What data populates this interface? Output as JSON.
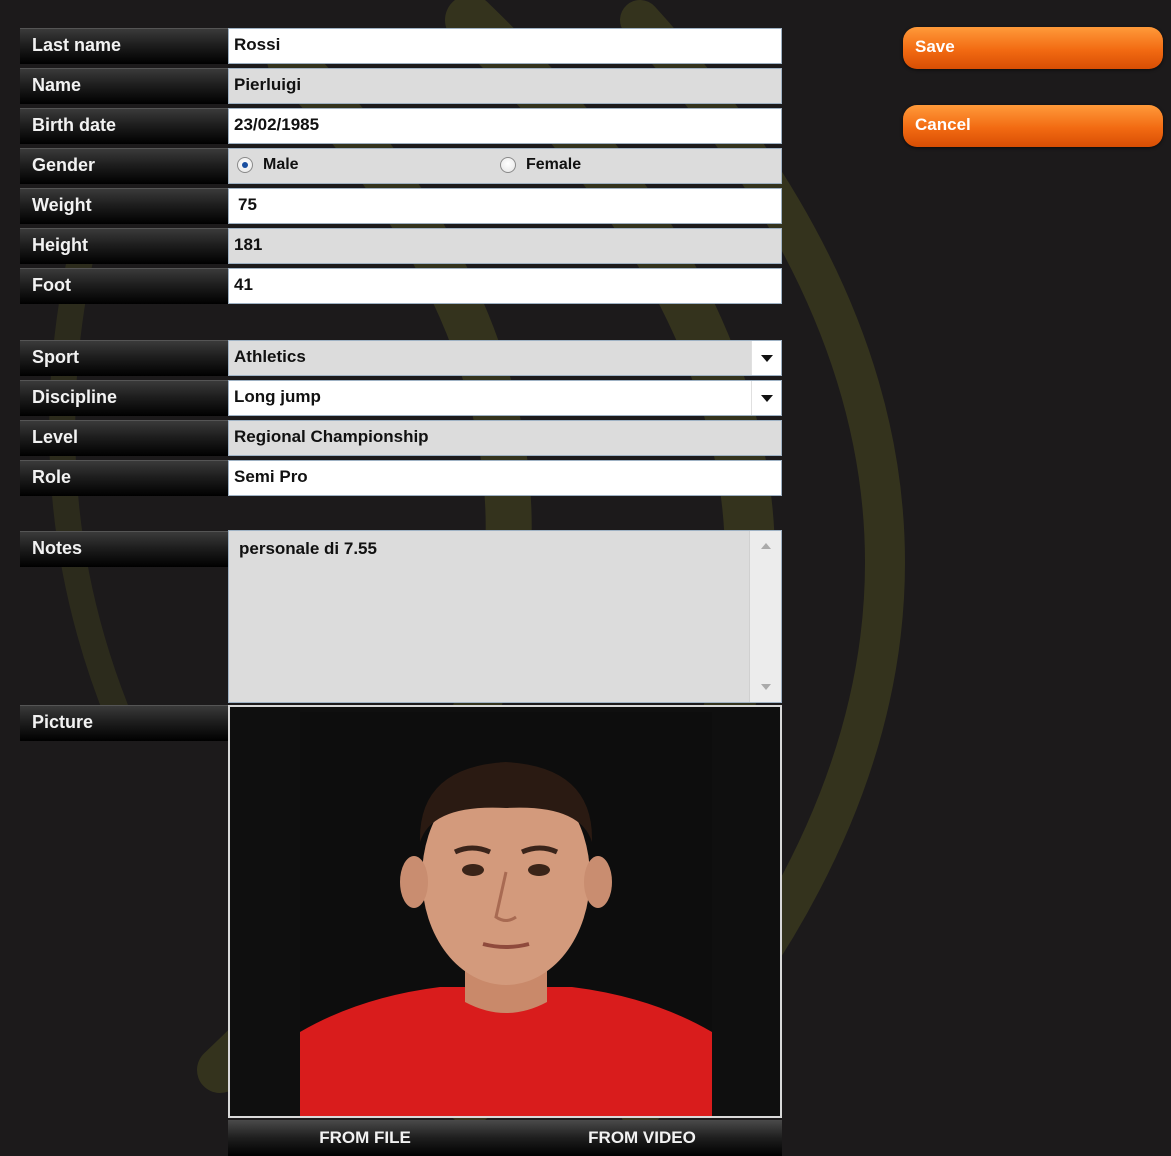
{
  "form": {
    "last_name": {
      "label": "Last name",
      "value": "Rossi"
    },
    "name": {
      "label": "Name",
      "value": "Pierluigi"
    },
    "birth_date": {
      "label": "Birth date",
      "value": "23/02/1985"
    },
    "gender": {
      "label": "Gender",
      "male": "Male",
      "female": "Female",
      "selected": "Male"
    },
    "weight": {
      "label": "Weight",
      "value": "75"
    },
    "height": {
      "label": "Height",
      "value": "181"
    },
    "foot": {
      "label": "Foot",
      "value": "41"
    },
    "sport": {
      "label": "Sport",
      "value": "Athletics"
    },
    "discipline": {
      "label": "Discipline",
      "value": "Long jump"
    },
    "level": {
      "label": "Level",
      "value": "Regional Championship"
    },
    "role": {
      "label": "Role",
      "value": "Semi Pro"
    },
    "notes": {
      "label": "Notes",
      "value": "personale di 7.55"
    },
    "picture": {
      "label": "Picture",
      "from_file": "FROM FILE",
      "from_video": "FROM VIDEO"
    }
  },
  "actions": {
    "save": "Save",
    "cancel": "Cancel"
  },
  "colors": {
    "accent": "#f26a12",
    "background": "#1c1a1b",
    "field_grey": "#dcdcdc",
    "arc": "#3b3a20"
  }
}
